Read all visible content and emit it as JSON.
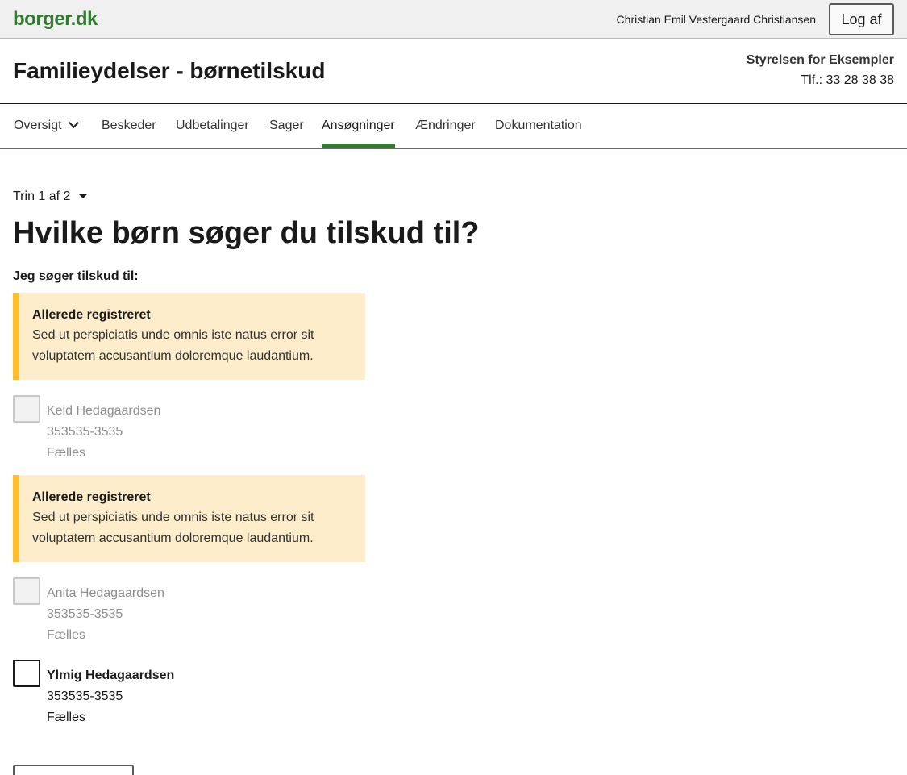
{
  "topbar": {
    "logo": "borger.dk",
    "username": "Christian Emil Vestergaard Christiansen",
    "logout_label": "Log af"
  },
  "header": {
    "title": "Familieydelser - børnetilskud",
    "agency": "Styrelsen for Eksempler",
    "phone": "Tlf.: 33 28 38 38"
  },
  "nav": {
    "items": [
      {
        "label": "Oversigt"
      },
      {
        "label": "Beskeder"
      },
      {
        "label": "Udbetalinger"
      },
      {
        "label": "Sager"
      },
      {
        "label": "Ansøgninger",
        "active": true
      },
      {
        "label": "Ændringer"
      },
      {
        "label": "Dokumentation"
      }
    ]
  },
  "form": {
    "step": "Trin 1 af 2",
    "question": "Hvilke børn søger du tilskud til?",
    "legend": "Jeg søger tilskud til:",
    "alerts": [
      {
        "title": "Allerede registreret",
        "line1": "Sed ut perspiciatis unde omnis iste natus error sit",
        "line2": "voluptatem accusantium doloremque laudantium."
      },
      {
        "title": "Allerede registreret",
        "line1": "Sed ut perspiciatis unde omnis iste natus error sit",
        "line2": "voluptatem accusantium doloremque laudantium."
      }
    ],
    "children": [
      {
        "name": "Keld Hedagaardsen",
        "cpr": "353535-3535",
        "custody": "Fælles",
        "disabled": true,
        "checked": false
      },
      {
        "name": "Anita Hedagaardsen",
        "cpr": "353535-3535",
        "custody": "Fælles",
        "disabled": true,
        "checked": false
      },
      {
        "name": "Ylmig Hedagaardsen",
        "cpr": "353535-3535",
        "custody": "Fælles",
        "disabled": false,
        "checked": false
      }
    ]
  },
  "colors": {
    "brand_green": "#357a32",
    "alert_bg": "#fdedcb",
    "alert_border": "#fdbf2d"
  }
}
